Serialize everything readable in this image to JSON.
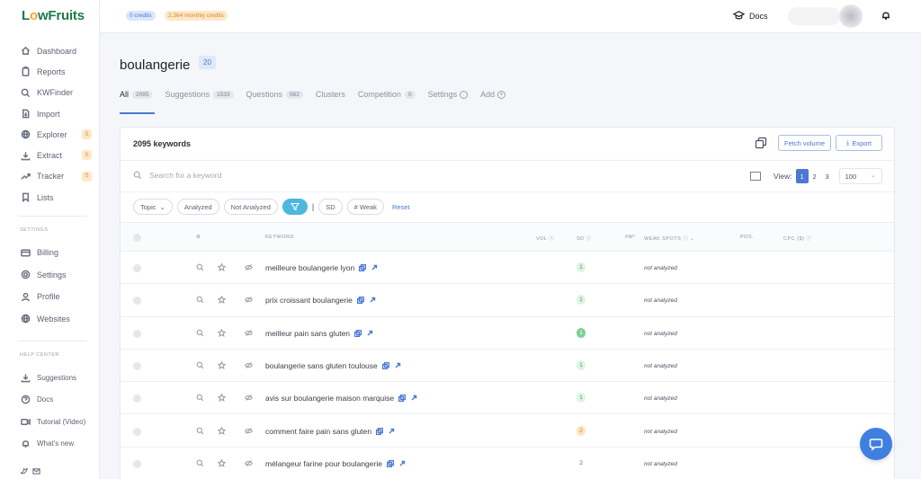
{
  "brand": {
    "name_pre": "L",
    "name_dot": "o",
    "name_post": "wFruits"
  },
  "sidebar": {
    "items": [
      {
        "label": "Dashboard"
      },
      {
        "label": "Reports"
      },
      {
        "label": "KWFinder"
      },
      {
        "label": "Import"
      },
      {
        "label": "Explorer",
        "badge": "S"
      },
      {
        "label": "Extract",
        "badge": "S"
      },
      {
        "label": "Tracker",
        "badge": "S"
      },
      {
        "label": "Lists"
      }
    ],
    "settings_label": "SETTINGS",
    "settings_items": [
      {
        "label": "Billing"
      },
      {
        "label": "Settings"
      },
      {
        "label": "Profile"
      },
      {
        "label": "Websites"
      }
    ],
    "help_label": "HELP CENTER",
    "help_items": [
      {
        "label": "Suggestions"
      },
      {
        "label": "Docs"
      },
      {
        "label": "Tutorial (Video)"
      },
      {
        "label": "What's new"
      }
    ]
  },
  "topbar": {
    "credits": "0 credits",
    "monthly": "2,364 monthly credits",
    "docs_label": "Docs"
  },
  "page": {
    "title": "boulangerie",
    "title_badge": "20",
    "tabs": [
      {
        "label": "All",
        "count": "2095"
      },
      {
        "label": "Suggestions",
        "count": "1533"
      },
      {
        "label": "Questions",
        "count": "562"
      },
      {
        "label": "Clusters",
        "count": ""
      },
      {
        "label": "Competition",
        "count": "0"
      },
      {
        "label": "Settings",
        "count": ""
      },
      {
        "label": "Add",
        "count": ""
      }
    ]
  },
  "card": {
    "kw_count": "2095 keywords",
    "fetch_label": "Fetch volume",
    "export_label": "Export",
    "search_placeholder": "Search for a keyword",
    "view_label": "View:",
    "pages": [
      "1",
      "2",
      "3"
    ],
    "per_page": "100",
    "filters": {
      "topic": "Topic",
      "analyzed": "Analyzed",
      "not_analyzed": "Not Analyzed",
      "sd": "SD",
      "weak": "# Weak",
      "reset": "Reset"
    },
    "headers": {
      "keyword": "KEYWORD",
      "vol": "VOL",
      "sd": "SD",
      "wp": "#W²",
      "weak_spots": "WEAK SPOTS",
      "pos": "POS.",
      "cpc": "CPC ($)"
    },
    "rows": [
      {
        "keyword": "meilleure boulangerie lyon",
        "sd": "1",
        "sd_style": "green",
        "weak": "not analyzed"
      },
      {
        "keyword": "prix croissant boulangerie",
        "sd": "1",
        "sd_style": "green",
        "weak": "not analyzed"
      },
      {
        "keyword": "meilleur pain sans gluten",
        "sd": "1",
        "sd_style": "greendark",
        "weak": "not analyzed"
      },
      {
        "keyword": "boulangerie sans gluten toulouse",
        "sd": "1",
        "sd_style": "green",
        "weak": "not analyzed"
      },
      {
        "keyword": "avis sur boulangerie maison marquise",
        "sd": "1",
        "sd_style": "green",
        "weak": "not analyzed"
      },
      {
        "keyword": "comment faire pain sans gluten",
        "sd": "2",
        "sd_style": "orange",
        "weak": "not analyzed"
      },
      {
        "keyword": "mélangeur farine pour boulangerie",
        "sd": "2",
        "sd_style": "plain",
        "weak": "not analyzed"
      }
    ]
  }
}
